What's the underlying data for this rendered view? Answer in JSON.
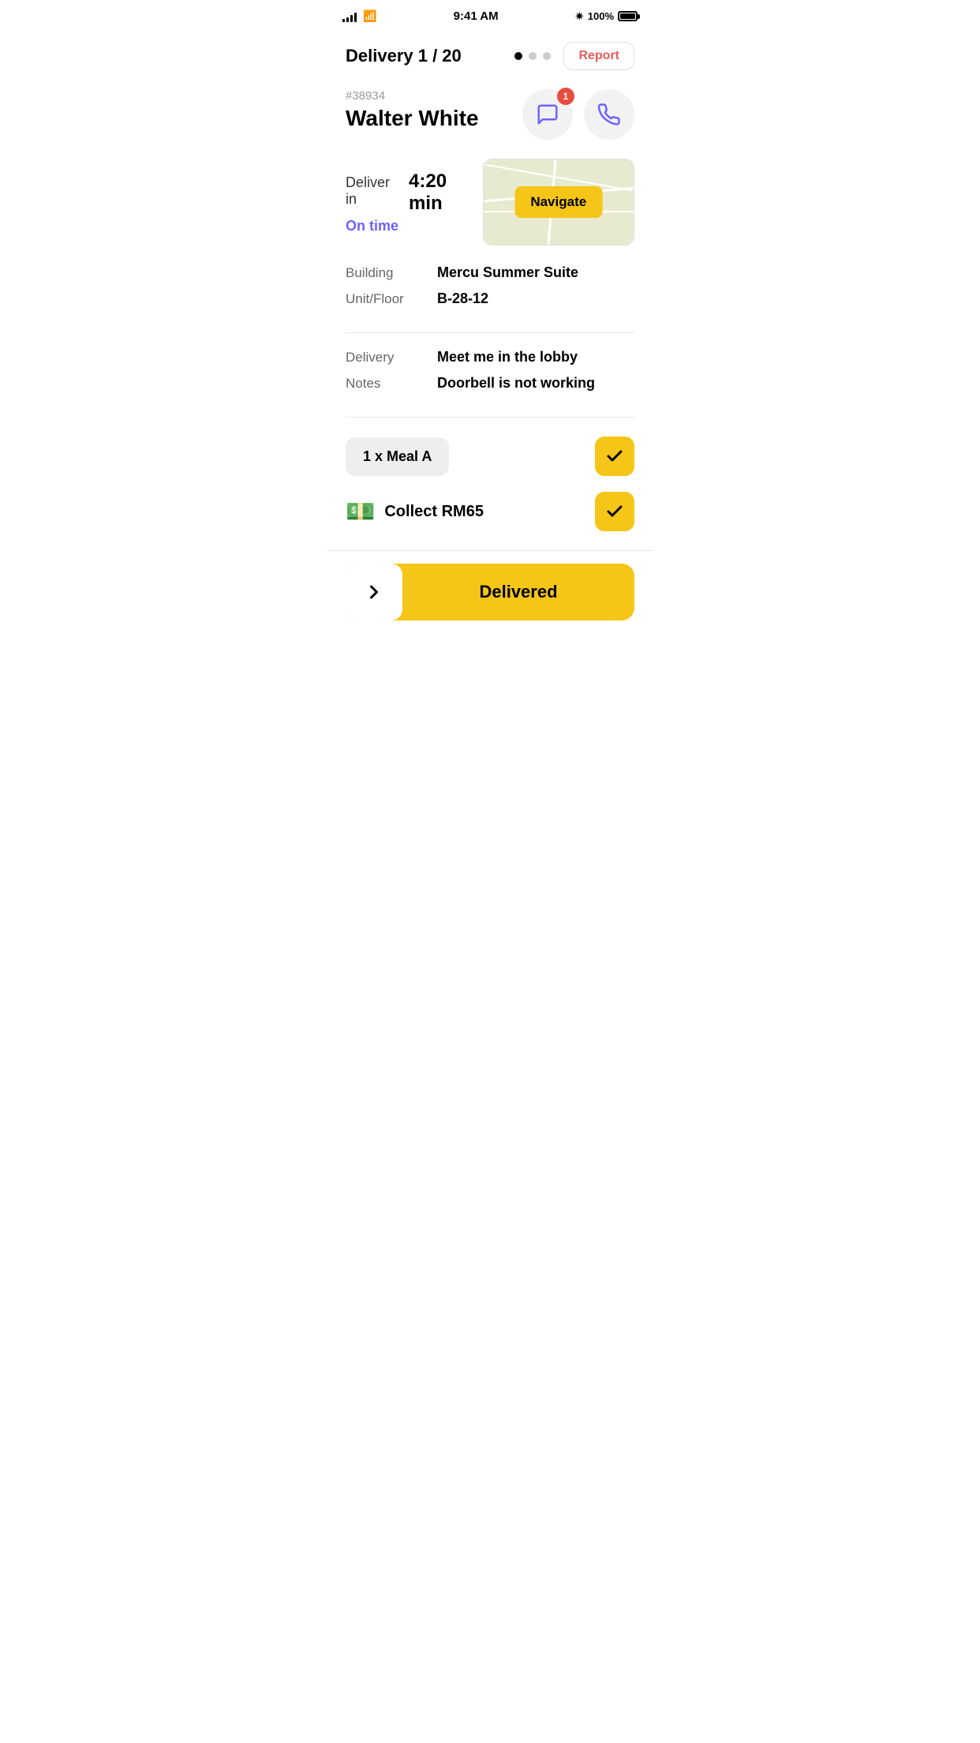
{
  "statusBar": {
    "time": "9:41 AM",
    "battery": "100%",
    "bluetooth": "BT"
  },
  "header": {
    "deliveryLabel": "Delivery 1 / 20",
    "reportLabel": "Report",
    "dots": [
      {
        "active": true
      },
      {
        "active": false
      },
      {
        "active": false
      }
    ]
  },
  "customer": {
    "orderNumber": "#38934",
    "name": "Walter White",
    "messageBadge": "1"
  },
  "deliveryTime": {
    "label": "Deliver in",
    "time": "4:20 min",
    "status": "On time",
    "navigateLabel": "Navigate"
  },
  "building": {
    "buildingLabel": "Building",
    "buildingValue": "Mercu Summer Suite",
    "unitLabel": "Unit/Floor",
    "unitValue": "B-28-12"
  },
  "deliveryNotes": {
    "deliveryLabel": "Delivery",
    "deliveryValue": "Meet me in the lobby",
    "notesLabel": "Notes",
    "notesValue": "Doorbell is not working"
  },
  "orderItems": {
    "itemLabel": "1 x Meal A",
    "collectLabel": "Collect RM65"
  },
  "footer": {
    "deliveredLabel": "Delivered"
  }
}
